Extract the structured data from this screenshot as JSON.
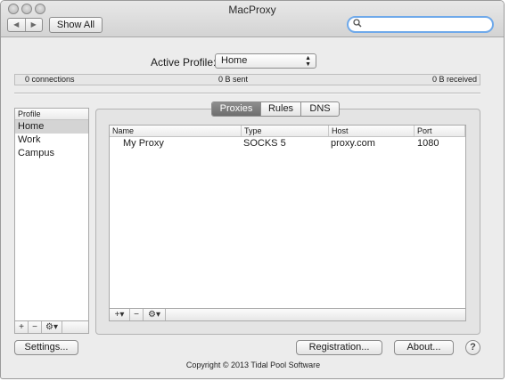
{
  "window": {
    "title": "MacProxy"
  },
  "toolbar": {
    "back_glyph": "◀",
    "forward_glyph": "▶",
    "show_all_label": "Show All",
    "search_placeholder": "",
    "search_icon": "magnifier-icon"
  },
  "profile": {
    "label": "Active Profile:",
    "selected": "Home"
  },
  "status": {
    "connections": "0 connections",
    "sent": "0 B sent",
    "received": "0 B received"
  },
  "profiles_list": {
    "header": "Profile",
    "items": [
      {
        "label": "Home",
        "selected": true
      },
      {
        "label": "Work"
      },
      {
        "label": "Campus"
      }
    ],
    "footer": {
      "add": "+",
      "remove": "−",
      "gear": "⚙▾"
    }
  },
  "tabs": [
    {
      "label": "Proxies",
      "active": true
    },
    {
      "label": "Rules"
    },
    {
      "label": "DNS"
    }
  ],
  "proxy_table": {
    "columns": [
      "Name",
      "Type",
      "Host",
      "Port"
    ],
    "rows": [
      [
        "My Proxy",
        "SOCKS 5",
        "proxy.com",
        "1080"
      ]
    ],
    "footer": {
      "add": "+▾",
      "remove": "−",
      "gear": "⚙▾"
    }
  },
  "buttons": {
    "settings": "Settings...",
    "registration": "Registration...",
    "about": "About...",
    "help": "?"
  },
  "footer": {
    "copyright": "Copyright © 2013 Tidal Pool Software"
  }
}
